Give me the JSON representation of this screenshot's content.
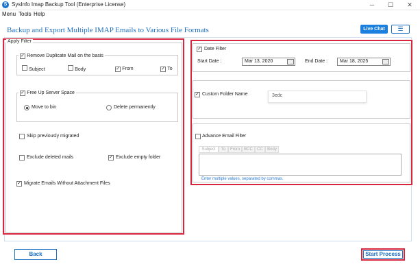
{
  "window": {
    "title": "SysInfo Imap Backup Tool (Enterprise License)",
    "app_icon": "S",
    "minimize": "─",
    "maximize": "☐",
    "close": "✕"
  },
  "menu": [
    "Menu",
    "Tools",
    "Help"
  ],
  "header": {
    "title": "Backup and Export Multiple IMAP Emails to Various File Formats",
    "live_chat": "Live Chat",
    "hamburger": "☰"
  },
  "apply_filter": {
    "legend": "Apply Filter",
    "remove_duplicates": {
      "label": "Remove Duplicate Mail on the basis",
      "checked": true,
      "options": [
        {
          "label": "Subject",
          "checked": false
        },
        {
          "label": "Body",
          "checked": false
        },
        {
          "label": "From",
          "checked": true
        },
        {
          "label": "To",
          "checked": true
        }
      ]
    },
    "free_up": {
      "label": "Free Up Server Space",
      "checked": true,
      "move_to_bin": "Move to bin",
      "delete_permanently": "Delete permanently",
      "selected": "Move to bin"
    },
    "skip_migrated": {
      "label": "Skip previously migrated",
      "checked": false
    },
    "exclude_deleted": {
      "label": "Exclude deleted mails",
      "checked": false
    },
    "exclude_empty": {
      "label": "Exclude empty folder",
      "checked": true
    },
    "without_attachment": {
      "label": "Migrate Emails Without Attachment Files",
      "checked": true
    }
  },
  "date_filter": {
    "label": "Date Filter",
    "checked": true,
    "start_label": "Start Date :",
    "start_value": "Mar 13, 2020",
    "end_label": "End Date :",
    "end_value": "Mar 18, 2025"
  },
  "custom_folder": {
    "label": "Custom Folder Name",
    "checked": true,
    "value": "3edc"
  },
  "advance_filter": {
    "label": "Advance Email Filter",
    "checked": false,
    "tabs": [
      "Subject",
      "To",
      "From",
      "BCC",
      "CC",
      "Body"
    ],
    "hint": "Enter multiple values, separated by commas."
  },
  "footer": {
    "back": "Back",
    "start": "Start Process"
  },
  "check_mark": "✓",
  "colors": {
    "accent": "#1b6fc0",
    "highlight": "#d7263d",
    "live_chat_bg": "#1b7fe0"
  }
}
